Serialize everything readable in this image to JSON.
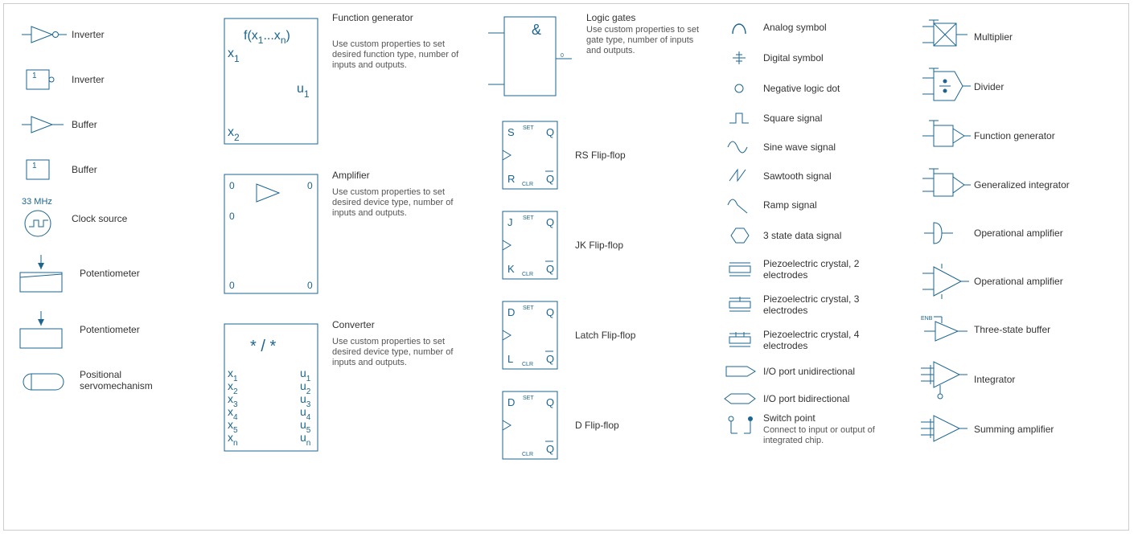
{
  "col1": {
    "inverter": "Inverter",
    "inverter2": "Inverter",
    "buffer": "Buffer",
    "buffer2": "Buffer",
    "clock_source": "Clock source",
    "clock_freq": "33 MHz",
    "potentiometer": "Potentiometer",
    "potentiometer2": "Potentiometer",
    "positional": "Positional servomechanism",
    "box1": "1"
  },
  "col2": {
    "fgen": "Function generator",
    "fgen_desc": "Use custom properties to set desired function type, number of inputs and outputs.",
    "fgen_fx": "f(x",
    "fgen_dots": "...x",
    "fgen_x1": "x",
    "fgen_x2": "x",
    "fgen_u1": "u",
    "amp": "Amplifier",
    "amp_desc": "Use custom properties to set desired device type, number of inputs and outputs.",
    "zero": "0",
    "conv": "Converter",
    "conv_desc": "Use custom properties to set desired device type, number of inputs and outputs.",
    "star_slash": "* / *",
    "x": "x",
    "u": "u",
    "n": "n",
    "s1": "1",
    "s2": "2",
    "s3": "3",
    "s4": "4",
    "s5": "5"
  },
  "col3": {
    "logic_gates": "Logic gates",
    "logic_desc": "Use custom properties to set gate type, number of inputs and outputs.",
    "amp_sym": "&",
    "rs": "RS Flip-flop",
    "jk": "JK Flip-flop",
    "latch": "Latch Flip-flop",
    "d": "D Flip-flop",
    "set": "SET",
    "clr": "CLR",
    "q": "Q",
    "qn": "Q",
    "S": "S",
    "R": "R",
    "J": "J",
    "K": "K",
    "D": "D",
    "L": "L",
    "zero": "0"
  },
  "col4": {
    "analog": "Analog symbol",
    "digital": "Digital symbol",
    "neglogic": "Negative logic dot",
    "square": "Square signal",
    "sine": "Sine wave signal",
    "sawtooth": "Sawtooth signal",
    "ramp": "Ramp signal",
    "threestate": "3 state data signal",
    "piezo2": "Piezoelectric crystal, 2 electrodes",
    "piezo3": "Piezoelectric crystal, 3 electrodes",
    "piezo4": "Piezoelectric crystal, 4 electrodes",
    "io_uni": "I/O port unidirectional",
    "io_bi": "I/O port bidirectional",
    "switch": "Switch point",
    "switch_desc": "Connect to input or output of integrated chip."
  },
  "col5": {
    "mult": "Multiplier",
    "div": "Divider",
    "fgen": "Function generator",
    "genint": "Generalized integrator",
    "opamp": "Operational amplifier",
    "opamp2": "Operational amplifier",
    "tsbuf": "Three-state buffer",
    "enb": "ENB",
    "integ": "Integrator",
    "sumamp": "Summing amplifier"
  }
}
